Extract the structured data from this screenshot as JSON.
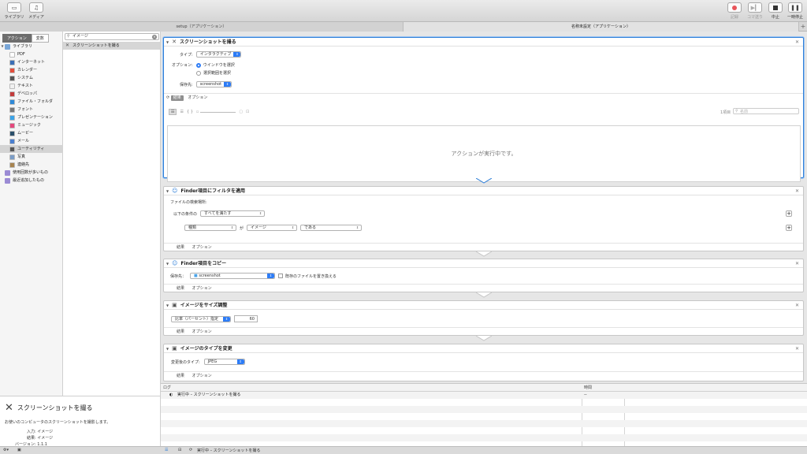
{
  "toolbar": {
    "library_label": "ライブラリ",
    "media_label": "メディア",
    "record_label": "記録",
    "step_label": "コマ送り",
    "stop_label": "中止",
    "pause_label": "一時停止"
  },
  "tabs": [
    {
      "label": "setup（アプリケーション）"
    },
    {
      "label": "名称未設定（アプリケーション）"
    }
  ],
  "library": {
    "seg_actions": "アクション",
    "seg_variables": "変数",
    "root": "ライブラリ",
    "items": [
      {
        "label": "PDF",
        "color": "#ffffff"
      },
      {
        "label": "インターネット",
        "color": "#3b6fb5"
      },
      {
        "label": "カレンダー",
        "color": "#e44d3b"
      },
      {
        "label": "システム",
        "color": "#555555"
      },
      {
        "label": "テキスト",
        "color": "#f0f0f0"
      },
      {
        "label": "デベロッパ",
        "color": "#c33b3b"
      },
      {
        "label": "ファイル・フォルダ",
        "color": "#2f8ad8"
      },
      {
        "label": "フォント",
        "color": "#777777"
      },
      {
        "label": "プレゼンテーション",
        "color": "#3aa3e8"
      },
      {
        "label": "ミュージック",
        "color": "#e5487c"
      },
      {
        "label": "ムービー",
        "color": "#2a4f6a"
      },
      {
        "label": "メール",
        "color": "#4a7fd0"
      },
      {
        "label": "ユーティリティ",
        "color": "#555555"
      },
      {
        "label": "写真",
        "color": "#7a9cc7"
      },
      {
        "label": "連絡先",
        "color": "#a88450"
      }
    ],
    "smart_items": [
      {
        "label": "使用回数が多いもの"
      },
      {
        "label": "最近追加したもの"
      }
    ]
  },
  "actions": {
    "search_value": "イメージ",
    "result": "スクリーンショットを撮る"
  },
  "description": {
    "title": "スクリーンショットを撮る",
    "text": "お使いのコンピュータのスクリーンショットを撮影します。",
    "input_label": "入力:",
    "input_value": "イメージ",
    "result_label": "結果:",
    "result_value": "イメージ",
    "version_label": "バージョン:",
    "version_value": "1.1.1"
  },
  "panels": {
    "screenshot": {
      "title": "スクリーンショットを撮る",
      "type_label": "タイプ:",
      "type_value": "インタラクティブ",
      "option_label": "オプション:",
      "radio1": "ウインドウを選択",
      "radio2": "選択範囲を選択",
      "save_label": "保存先:",
      "save_value": "screenshot",
      "result_btn": "結果",
      "options_btn": "オプション",
      "count": "1項目",
      "name_placeholder": "名前",
      "running_msg": "アクションが実行中です。"
    },
    "filter": {
      "title": "Finder項目にフィルタを適用",
      "search_label": "ファイルの検索場所:",
      "cond_prefix": "以下の条件の",
      "cond_value": "すべてを満たす",
      "field1": "種類",
      "ga": "が",
      "field2": "イメージ",
      "field3": "である",
      "result_btn": "結果",
      "options_btn": "オプション"
    },
    "copy": {
      "title": "Finder項目をコピー",
      "dest_label": "保存先：",
      "dest_value": "screenshot",
      "replace_label": "既存のファイルを置き換える",
      "result_btn": "結果",
      "options_btn": "オプション"
    },
    "resize": {
      "title": "イメージをサイズ調整",
      "mode_value": "比率（パーセント）指定",
      "amount": "60",
      "result_btn": "結果",
      "options_btn": "オプション"
    },
    "convert": {
      "title": "イメージのタイプを変更",
      "to_label": "変更後のタイプ:",
      "to_value": "JPEG",
      "result_btn": "結果",
      "options_btn": "オプション"
    }
  },
  "log": {
    "col_log": "ログ",
    "col_time": "時間",
    "row1": "実行中 – スクリーンショットを撮る",
    "row1_time": "--"
  },
  "statusbar": {
    "text": "実行中 – スクリーンショットを撮る"
  }
}
